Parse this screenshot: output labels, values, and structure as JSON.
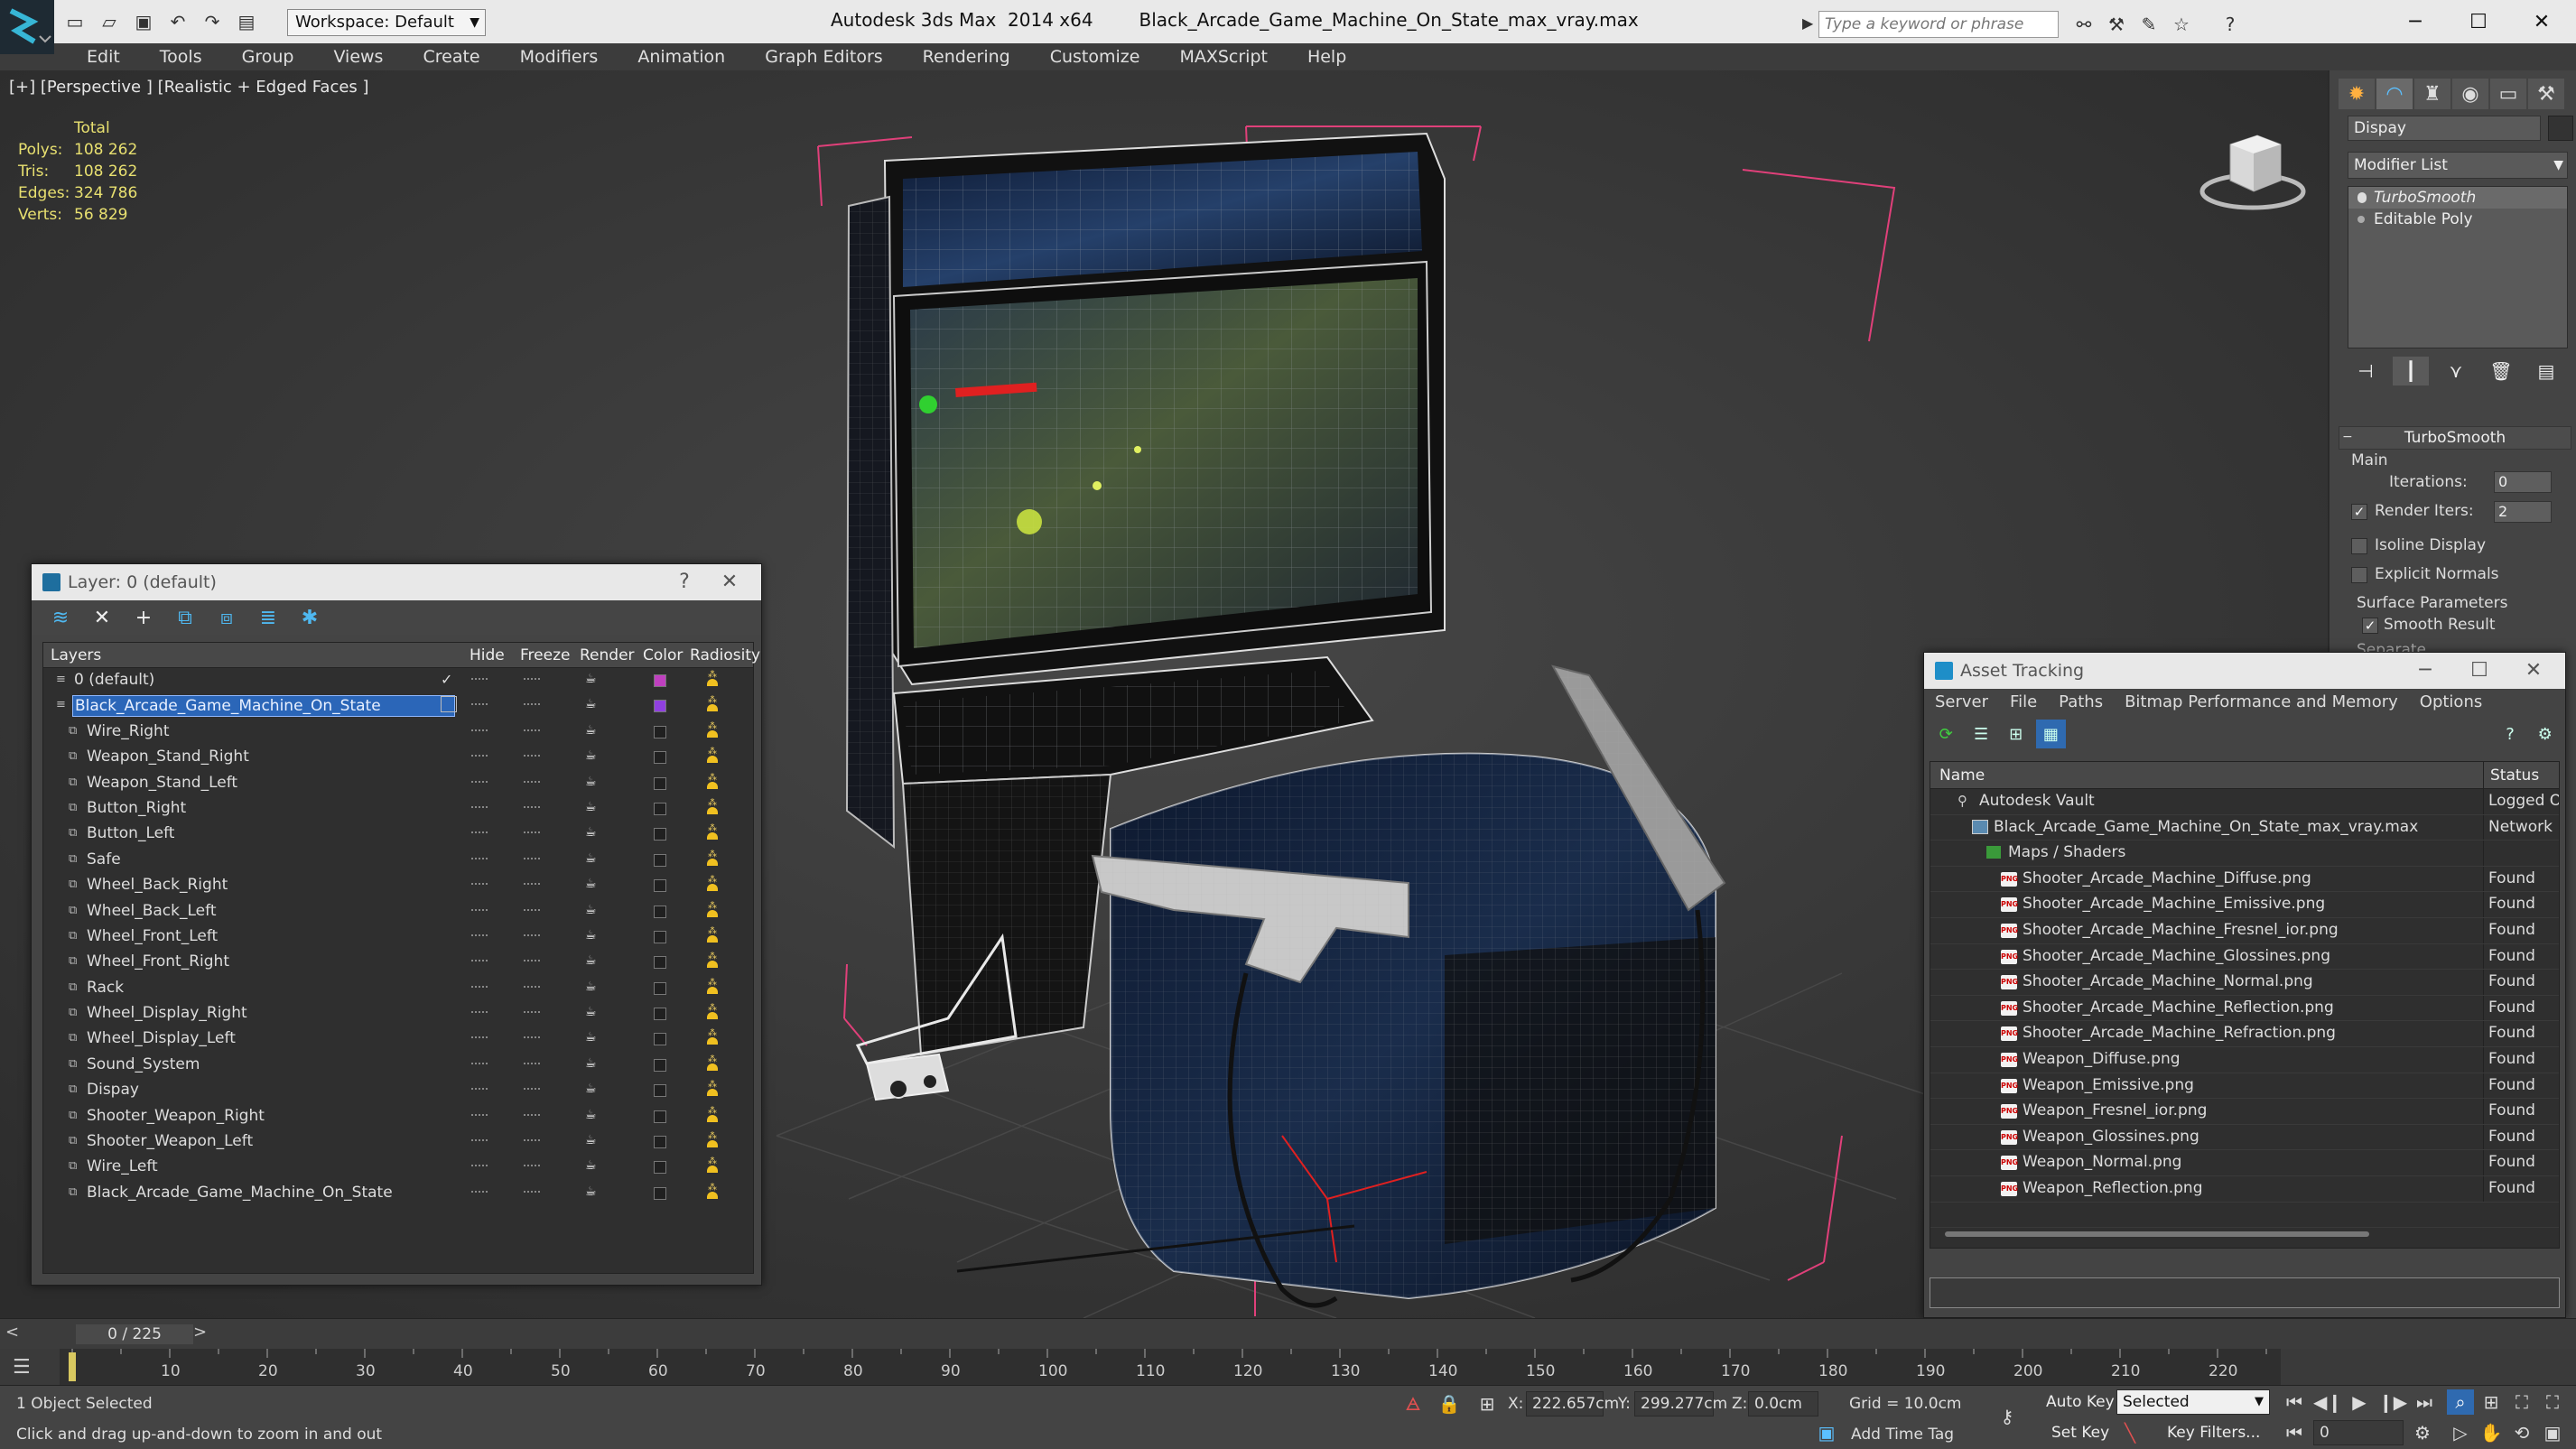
{
  "titlebar": {
    "workspace": "Workspace: Default",
    "app_title": "Autodesk 3ds Max  2014 x64",
    "file_title": "Black_Arcade_Game_Machine_On_State_max_vray.max",
    "search_placeholder": "Type a keyword or phrase"
  },
  "menu": [
    "Edit",
    "Tools",
    "Group",
    "Views",
    "Create",
    "Modifiers",
    "Animation",
    "Graph Editors",
    "Rendering",
    "Customize",
    "MAXScript",
    "Help"
  ],
  "viewport": {
    "label": "[+] [Perspective ] [Realistic + Edged Faces ]",
    "stats": {
      "header": "Total",
      "rows": [
        {
          "k": "Polys:",
          "v": "108 262"
        },
        {
          "k": "Tris:",
          "v": "108 262"
        },
        {
          "k": "Edges:",
          "v": "324 786"
        },
        {
          "k": "Verts:",
          "v": "56 829"
        }
      ]
    }
  },
  "command_panel": {
    "object_name": "Dispay",
    "modifier_list": "Modifier List",
    "stack": [
      "TurboSmooth",
      "Editable Poly"
    ],
    "rollout_title": "TurboSmooth",
    "main_label": "Main",
    "iterations_label": "Iterations:",
    "iterations_value": "0",
    "render_iters_label": "Render Iters:",
    "render_iters_value": "2",
    "isoline_label": "Isoline Display",
    "explicit_normals_label": "Explicit Normals",
    "surface_params_label": "Surface Parameters",
    "smooth_result_label": "Smooth Result",
    "separate_label": "Separate"
  },
  "layer_window": {
    "title": "Layer: 0 (default)",
    "help": "?",
    "columns": [
      "Layers",
      "Hide",
      "Freeze",
      "Render",
      "Color",
      "Radiosity"
    ],
    "rows": [
      {
        "name": "0 (default)",
        "level": 0,
        "color": "#c040c0",
        "check": true
      },
      {
        "name": "Black_Arcade_Game_Machine_On_State",
        "level": 0,
        "color": "#9040e0",
        "selected": true
      },
      {
        "name": "Wire_Right",
        "level": 1,
        "color": "#202020"
      },
      {
        "name": "Weapon_Stand_Right",
        "level": 1,
        "color": "#202020"
      },
      {
        "name": "Weapon_Stand_Left",
        "level": 1,
        "color": "#202020"
      },
      {
        "name": "Button_Right",
        "level": 1,
        "color": "#202020"
      },
      {
        "name": "Button_Left",
        "level": 1,
        "color": "#202020"
      },
      {
        "name": "Safe",
        "level": 1,
        "color": "#202020"
      },
      {
        "name": "Wheel_Back_Right",
        "level": 1,
        "color": "#202020"
      },
      {
        "name": "Wheel_Back_Left",
        "level": 1,
        "color": "#202020"
      },
      {
        "name": "Wheel_Front_Left",
        "level": 1,
        "color": "#202020"
      },
      {
        "name": "Wheel_Front_Right",
        "level": 1,
        "color": "#202020"
      },
      {
        "name": "Rack",
        "level": 1,
        "color": "#202020"
      },
      {
        "name": "Wheel_Display_Right",
        "level": 1,
        "color": "#202020"
      },
      {
        "name": "Wheel_Display_Left",
        "level": 1,
        "color": "#202020"
      },
      {
        "name": "Sound_System",
        "level": 1,
        "color": "#202020"
      },
      {
        "name": "Dispay",
        "level": 1,
        "color": "#202020"
      },
      {
        "name": "Shooter_Weapon_Right",
        "level": 1,
        "color": "#202020"
      },
      {
        "name": "Shooter_Weapon_Left",
        "level": 1,
        "color": "#202020"
      },
      {
        "name": "Wire_Left",
        "level": 1,
        "color": "#202020"
      },
      {
        "name": "Black_Arcade_Game_Machine_On_State",
        "level": 1,
        "color": "#202020"
      }
    ]
  },
  "asset_window": {
    "title": "Asset Tracking",
    "menu": [
      "Server",
      "File",
      "Paths",
      "Bitmap Performance and Memory",
      "Options"
    ],
    "columns": [
      "Name",
      "Status"
    ],
    "rows": [
      {
        "name": "Autodesk Vault",
        "level": 1,
        "status": "Logged O",
        "icon": "vault"
      },
      {
        "name": "Black_Arcade_Game_Machine_On_State_max_vray.max",
        "level": 2,
        "status": "Network",
        "icon": "max"
      },
      {
        "name": "Maps / Shaders",
        "level": 3,
        "status": "",
        "icon": "folder"
      },
      {
        "name": "Shooter_Arcade_Machine_Diffuse.png",
        "level": 4,
        "status": "Found",
        "icon": "png"
      },
      {
        "name": "Shooter_Arcade_Machine_Emissive.png",
        "level": 4,
        "status": "Found",
        "icon": "png"
      },
      {
        "name": "Shooter_Arcade_Machine_Fresnel_ior.png",
        "level": 4,
        "status": "Found",
        "icon": "png"
      },
      {
        "name": "Shooter_Arcade_Machine_Glossines.png",
        "level": 4,
        "status": "Found",
        "icon": "png"
      },
      {
        "name": "Shooter_Arcade_Machine_Normal.png",
        "level": 4,
        "status": "Found",
        "icon": "png"
      },
      {
        "name": "Shooter_Arcade_Machine_Reflection.png",
        "level": 4,
        "status": "Found",
        "icon": "png"
      },
      {
        "name": "Shooter_Arcade_Machine_Refraction.png",
        "level": 4,
        "status": "Found",
        "icon": "png"
      },
      {
        "name": "Weapon_Diffuse.png",
        "level": 4,
        "status": "Found",
        "icon": "png"
      },
      {
        "name": "Weapon_Emissive.png",
        "level": 4,
        "status": "Found",
        "icon": "png"
      },
      {
        "name": "Weapon_Fresnel_ior.png",
        "level": 4,
        "status": "Found",
        "icon": "png"
      },
      {
        "name": "Weapon_Glossines.png",
        "level": 4,
        "status": "Found",
        "icon": "png"
      },
      {
        "name": "Weapon_Normal.png",
        "level": 4,
        "status": "Found",
        "icon": "png"
      },
      {
        "name": "Weapon_Reflection.png",
        "level": 4,
        "status": "Found",
        "icon": "png"
      }
    ]
  },
  "timeline": {
    "frame_display": "0 / 225",
    "ticks": [
      "10",
      "20",
      "30",
      "40",
      "50",
      "60",
      "70",
      "80",
      "90",
      "100",
      "110",
      "120",
      "130",
      "140",
      "150",
      "160",
      "170",
      "180",
      "190",
      "200",
      "210",
      "220"
    ],
    "frame_count": 225
  },
  "statusbar": {
    "selection": "1 Object Selected",
    "prompt": "Click and drag up-and-down to zoom in and out",
    "x_label": "X:",
    "x_value": "222.657cm",
    "y_label": "Y:",
    "y_value": "299.277cm",
    "z_label": "Z:",
    "z_value": "0.0cm",
    "grid": "Grid = 10.0cm",
    "add_time_tag": "Add Time Tag",
    "auto_key": "Auto Key",
    "set_key": "Set Key",
    "selected_dropdown": "Selected",
    "key_filters": "Key Filters...",
    "current_frame": "0"
  },
  "colors": {
    "accent_blue": "#2b66b8",
    "wire_pink": "#e0407a",
    "stats_yellow": "#e8e070"
  }
}
